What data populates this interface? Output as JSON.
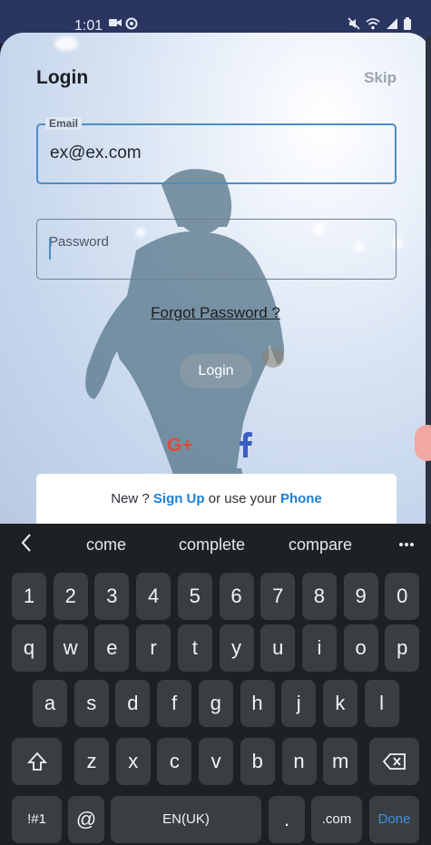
{
  "status_bar": {
    "time": "1:01"
  },
  "login": {
    "title": "Login",
    "skip": "Skip",
    "email_label": "Email",
    "email_value": "ex@ex.com",
    "password_placeholder": "Password",
    "forgot_password": "Forgot Password ?",
    "login_button": "Login",
    "google_label": "G+",
    "signup_prefix": "New ? ",
    "signup_link": "Sign Up",
    "signup_middle": " or use your ",
    "phone_link": "Phone"
  },
  "keyboard": {
    "suggestions": [
      "come",
      "complete",
      "compare"
    ],
    "number_row": [
      "1",
      "2",
      "3",
      "4",
      "5",
      "6",
      "7",
      "8",
      "9",
      "0"
    ],
    "row1": [
      "q",
      "w",
      "e",
      "r",
      "t",
      "y",
      "u",
      "i",
      "o",
      "p"
    ],
    "row2": [
      "a",
      "s",
      "d",
      "f",
      "g",
      "h",
      "j",
      "k",
      "l"
    ],
    "row3": [
      "z",
      "x",
      "c",
      "v",
      "b",
      "n",
      "m"
    ],
    "symbols_key": "!#1",
    "at_key": "@",
    "space_label": "EN(UK)",
    "period_key": ".",
    "dotcom_key": ".com",
    "done_key": "Done"
  },
  "colors": {
    "accent_blue": "#1f7fd2",
    "google_red": "#dd4b3e",
    "facebook_blue": "#3b5ec2",
    "keyboard_bg": "#1e2124",
    "key_bg": "#3a3e43"
  },
  "icons": [
    "video-camera-icon",
    "notification-icon",
    "mute-icon",
    "wifi-icon",
    "signal-icon",
    "battery-icon",
    "back-chevron-icon",
    "more-options-icon",
    "shift-icon",
    "backspace-icon",
    "google-plus-icon",
    "facebook-icon"
  ]
}
